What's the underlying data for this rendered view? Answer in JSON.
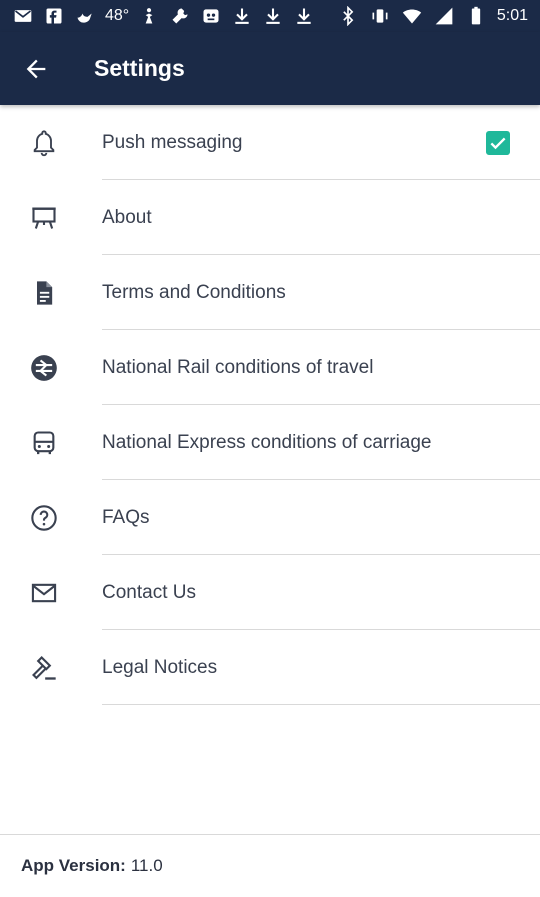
{
  "status_bar": {
    "temperature": "48°",
    "time": "5:01"
  },
  "header": {
    "title": "Settings"
  },
  "items": [
    {
      "label": "Push messaging",
      "icon": "bell-icon",
      "checked": true
    },
    {
      "label": "About",
      "icon": "easel-icon"
    },
    {
      "label": "Terms and Conditions",
      "icon": "document-icon"
    },
    {
      "label": "National Rail conditions of travel",
      "icon": "national-rail-icon"
    },
    {
      "label": "National Express conditions of carriage",
      "icon": "bus-icon"
    },
    {
      "label": "FAQs",
      "icon": "question-icon"
    },
    {
      "label": "Contact Us",
      "icon": "envelope-icon"
    },
    {
      "label": "Legal Notices",
      "icon": "gavel-icon"
    }
  ],
  "footer": {
    "version_label": "App Version:",
    "version_value": "11.0"
  },
  "colors": {
    "app_bar": "#1b2a47",
    "accent": "#1fb89a",
    "icon": "#3a4150"
  }
}
